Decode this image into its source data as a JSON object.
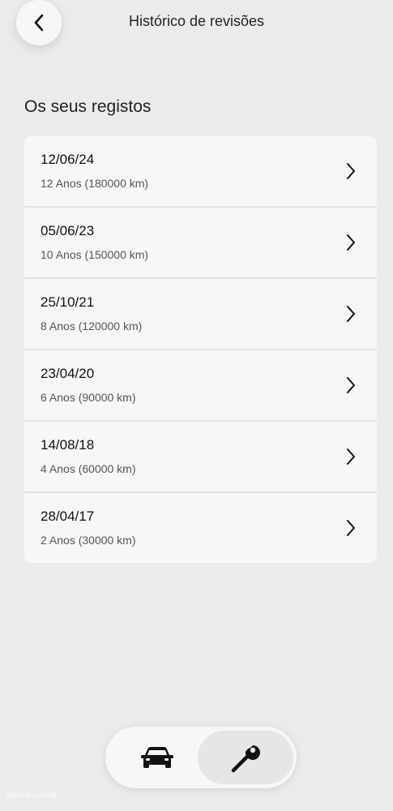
{
  "header": {
    "title": "Histórico de revisões",
    "back_icon": "chevron-left-icon"
  },
  "section": {
    "title": "Os seus registos"
  },
  "records": [
    {
      "date": "12/06/24",
      "detail": "12 Anos (180000 km)"
    },
    {
      "date": "05/06/23",
      "detail": "10 Anos (150000 km)"
    },
    {
      "date": "25/10/21",
      "detail": "8 Anos (120000 km)"
    },
    {
      "date": "23/04/20",
      "detail": "6 Anos (90000 km)"
    },
    {
      "date": "14/08/18",
      "detail": "4 Anos (60000 km)"
    },
    {
      "date": "28/04/17",
      "detail": "2 Anos (30000 km)"
    }
  ],
  "tabbar": {
    "tabs": [
      {
        "icon": "car-icon",
        "selected": false
      },
      {
        "icon": "wrench-icon",
        "selected": true
      }
    ]
  },
  "watermark": {
    "text": "standvirtual"
  },
  "colors": {
    "background": "#ebebea",
    "card": "#f7f7f6",
    "text_primary": "#111111",
    "text_secondary": "#555555"
  }
}
